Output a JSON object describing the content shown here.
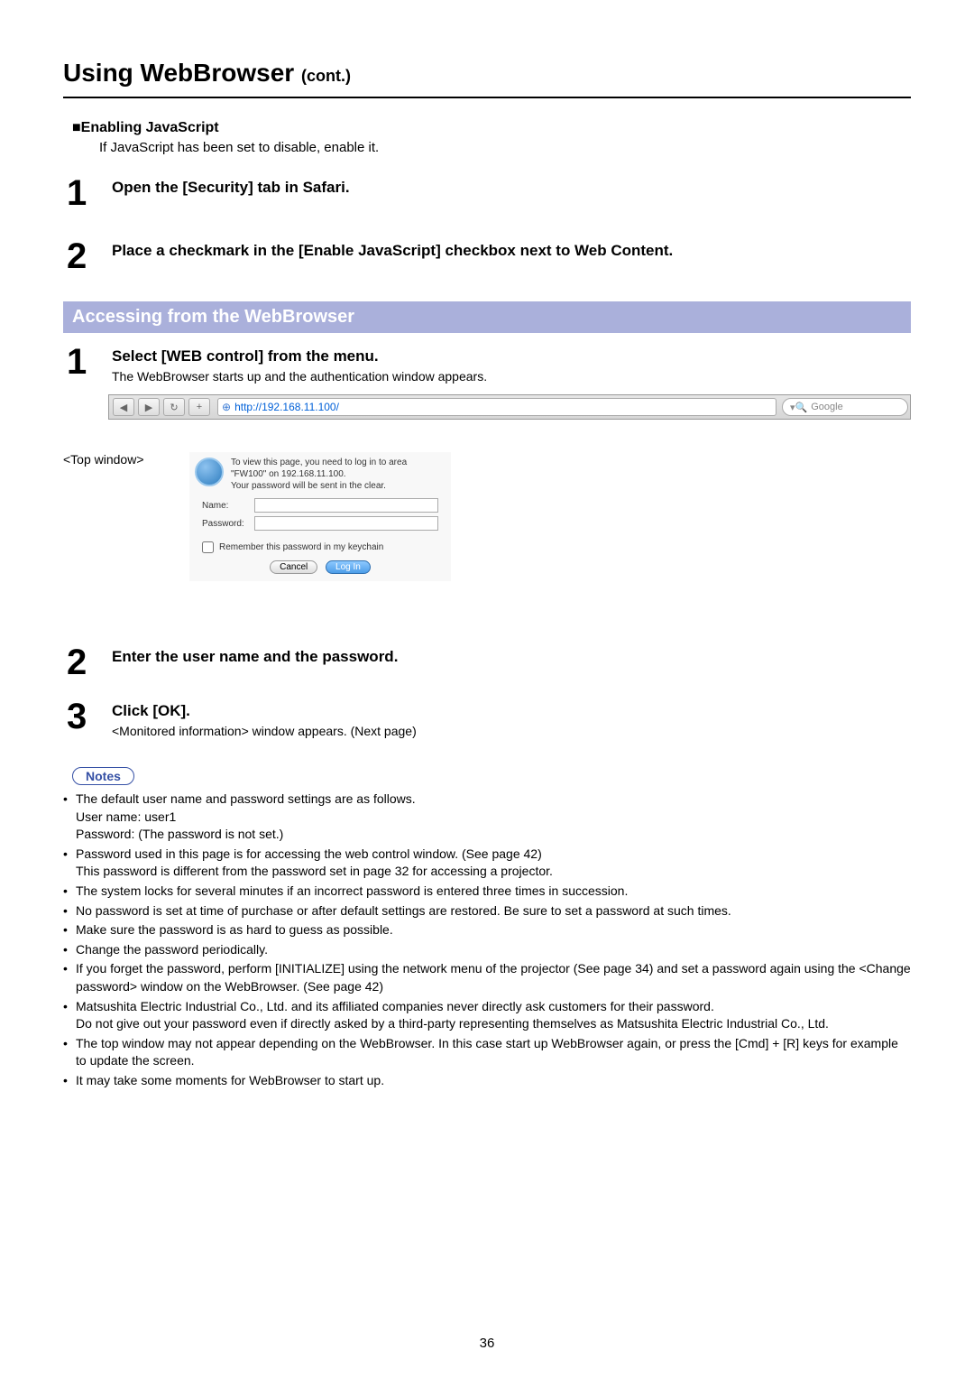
{
  "page": {
    "title_main": "Using WebBrowser ",
    "title_cont": "(cont.)",
    "number": "36"
  },
  "js_section": {
    "heading_prefix": "■",
    "heading": "Enabling JavaScript",
    "desc": "If JavaScript has been set to disable, enable it.",
    "step1_num": "1",
    "step1_title": "Open the [Security] tab in Safari.",
    "step2_num": "2",
    "step2_title": "Place a checkmark in the [Enable JavaScript] checkbox next to Web Content."
  },
  "access_section": {
    "bar": "Accessing from the WebBrowser",
    "step1_num": "1",
    "step1_title": "Select [WEB control] from the menu.",
    "step1_desc": "The WebBrowser starts up and the authentication window appears.",
    "step2_num": "2",
    "step2_title": "Enter the user name and the password.",
    "step3_num": "3",
    "step3_title": "Click [OK].",
    "step3_desc": "<Monitored information> window appears. (Next page)"
  },
  "browser": {
    "url": "http://192.168.11.100/",
    "search_placeholder": "Google",
    "back": "◀",
    "fwd": "▶",
    "reload": "↻",
    "add": "+"
  },
  "top_window_label": "<Top window>",
  "auth": {
    "line1": "To view this page, you need to log in to area",
    "line2": "\"FW100\" on 192.168.11.100.",
    "line3": "Your password will be sent in the clear.",
    "name_label": "Name:",
    "pass_label": "Password:",
    "remember": "Remember this password in my keychain",
    "cancel": "Cancel",
    "login": "Log In"
  },
  "notes_label": "Notes",
  "notes": [
    {
      "text": "The default user name and password settings are as follows.",
      "sub": [
        "User name: user1",
        "Password: (The password is not set.)"
      ]
    },
    {
      "text": "Password used in this page is for accessing the web control window. (See page 42)",
      "sub": [
        "This password is different from the password set in page 32 for accessing a projector."
      ]
    },
    {
      "text": "The system locks for several minutes if an incorrect password is entered three times in succession."
    },
    {
      "text": "No password is set at time of purchase or after default settings are restored. Be sure to set a password at such times."
    },
    {
      "text": "Make sure the password is as hard to guess as possible."
    },
    {
      "text": "Change the password periodically."
    },
    {
      "text": "If you forget the password, perform [INITIALIZE] using the network menu of the projector (See page 34) and set a password again using the <Change password> window on the WebBrowser. (See page 42)"
    },
    {
      "text": "Matsushita Electric Industrial Co., Ltd. and its affiliated companies never directly ask customers for their password.",
      "sub": [
        "Do not give out your password even if directly asked by a third-party representing themselves as Matsushita Electric Industrial Co., Ltd."
      ]
    },
    {
      "text": "The top window may not appear depending on the WebBrowser. In this case start up WebBrowser again, or press the [Cmd] + [R] keys for example to update the screen."
    },
    {
      "text": "It may take some moments for WebBrowser to start up."
    }
  ]
}
